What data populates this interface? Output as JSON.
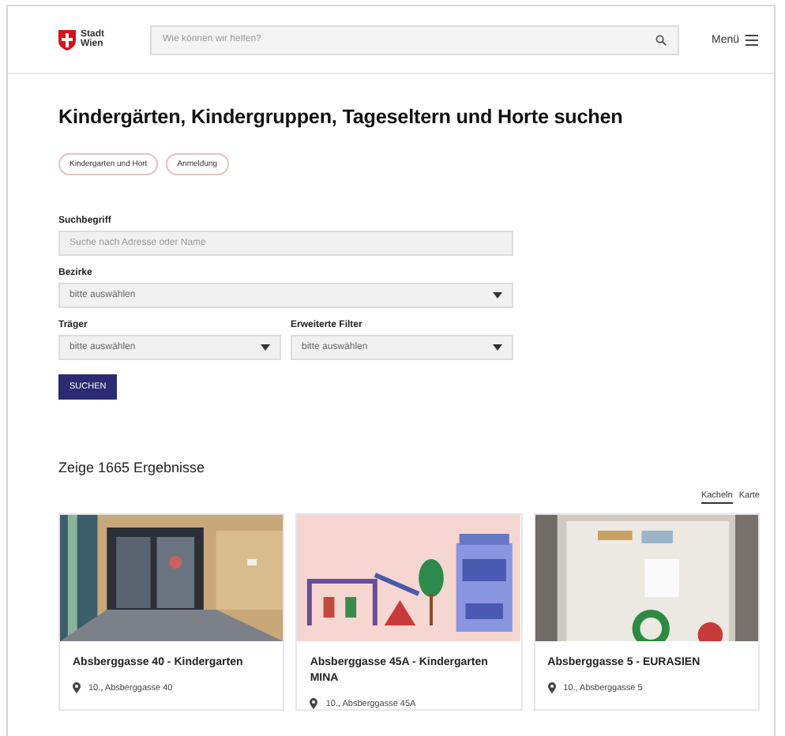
{
  "header": {
    "logo_text": "Stadt Wien",
    "search": {
      "placeholder": "Wie können wir helfen?"
    },
    "menu": "Menü"
  },
  "title": "Kindergärten, Kindergruppen, Tageseltern und Horte suchen",
  "tags": [
    "Kindergarten und Hort",
    "Anmeldung"
  ],
  "form": {
    "rows": [
      [
        {
          "kind": "text",
          "label": "Suchbegriff",
          "placeholder": "Suche nach Adresse oder Name"
        }
      ],
      [
        {
          "kind": "select",
          "label": "Bezirke",
          "value": "bitte auswählen"
        }
      ],
      [
        {
          "kind": "select",
          "label": "Träger",
          "value": "bitte auswählen"
        },
        {
          "kind": "select",
          "label": "Erweiterte Filter",
          "value": "bitte auswählen"
        }
      ]
    ],
    "submit": "SUCHEN"
  },
  "results": {
    "count_text": "Zeige 1665 Ergebnisse",
    "views": [
      {
        "label": "Kacheln",
        "selected": true
      },
      {
        "label": "Karte",
        "selected": false
      }
    ],
    "cards": [
      {
        "title": "Absberggasse 40 - Kindergarten",
        "address": "10., Absberggasse 40"
      },
      {
        "title": "Absberggasse 45A - Kindergarten MINA",
        "address": "10., Absberggasse 45A"
      },
      {
        "title": "Absberggasse 5 - EURASIEN",
        "address": "10., Absberggasse 5"
      }
    ]
  }
}
